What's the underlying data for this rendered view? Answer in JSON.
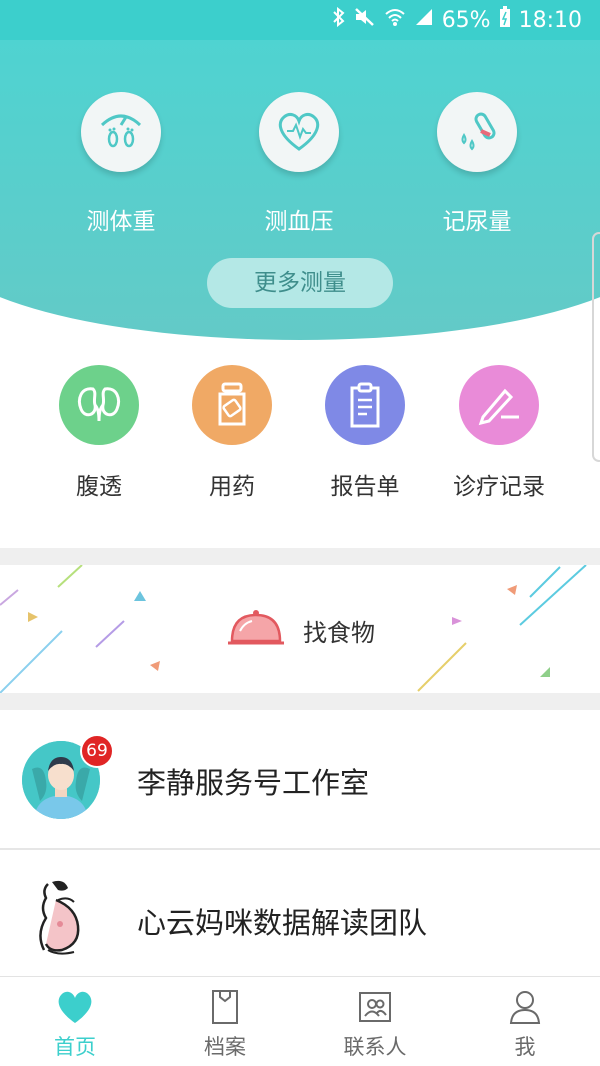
{
  "status_bar": {
    "battery": "65%",
    "time": "18:10"
  },
  "measure": {
    "items": [
      {
        "label": "测体重",
        "icon": "scale-icon"
      },
      {
        "label": "测血压",
        "icon": "heart-pulse-icon"
      },
      {
        "label": "记尿量",
        "icon": "test-tube-icon"
      }
    ],
    "more_label": "更多测量"
  },
  "features": [
    {
      "label": "腹透",
      "icon": "kidney-icon",
      "color": "#6dd18b"
    },
    {
      "label": "用药",
      "icon": "medicine-bottle-icon",
      "color": "#f0a965"
    },
    {
      "label": "报告单",
      "icon": "clipboard-icon",
      "color": "#7f89e6"
    },
    {
      "label": "诊疗记录",
      "icon": "pen-icon",
      "color": "#e98bd8"
    }
  ],
  "food_banner": {
    "label": "找食物",
    "icon": "food-cloche-icon"
  },
  "contacts": [
    {
      "title": "李静服务号工作室",
      "badge": "69",
      "icon": "man-avatar-icon"
    },
    {
      "title": "心云妈咪数据解读团队",
      "icon": "pregnant-woman-icon"
    }
  ],
  "bottom_nav": {
    "active_color": "#3ccfcc",
    "items": [
      {
        "label": "首页",
        "icon": "heart-icon",
        "active": true
      },
      {
        "label": "档案",
        "icon": "folder-icon",
        "active": false
      },
      {
        "label": "联系人",
        "icon": "contacts-icon",
        "active": false
      },
      {
        "label": "我",
        "icon": "person-icon",
        "active": false
      }
    ]
  }
}
